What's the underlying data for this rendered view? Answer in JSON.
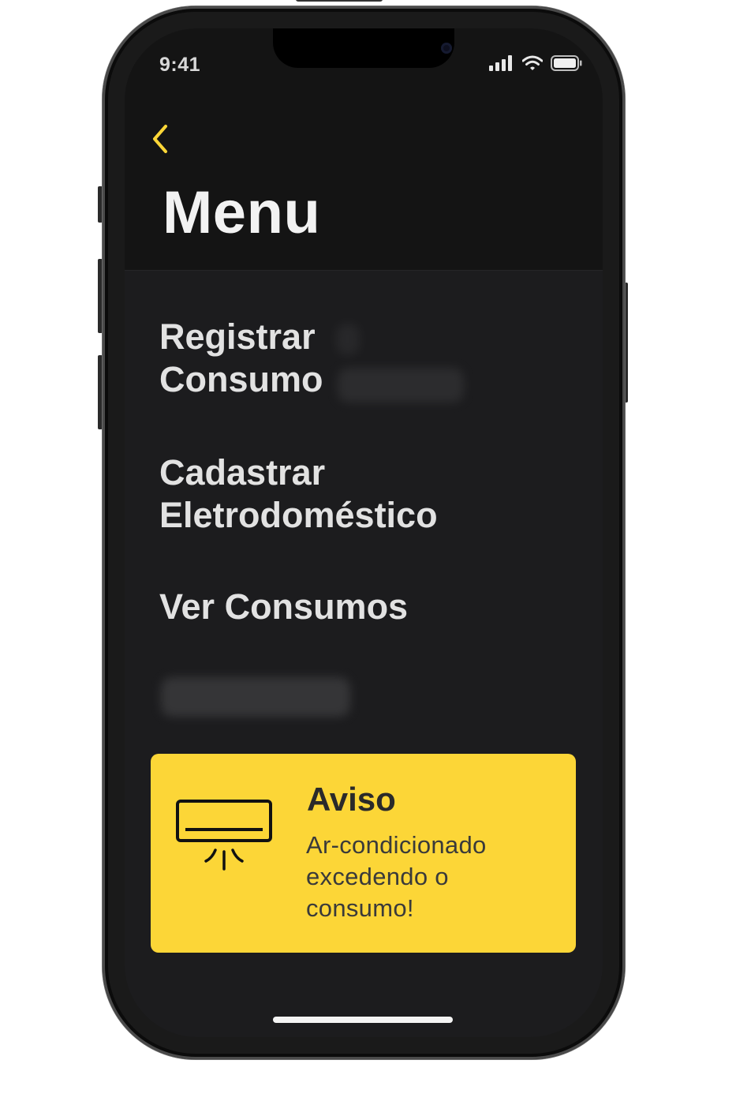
{
  "status_bar": {
    "time": "9:41",
    "signal_icon": "cellular-signal-icon",
    "wifi_icon": "wifi-icon",
    "battery_icon": "battery-icon"
  },
  "navigation": {
    "back_icon": "chevron-left-icon"
  },
  "header": {
    "title": "Menu"
  },
  "menu": {
    "items": [
      {
        "label": "Registrar\nConsumo"
      },
      {
        "label": "Cadastrar\nEletrodoméstico"
      },
      {
        "label": "Ver Consumos"
      }
    ]
  },
  "alert": {
    "icon": "air-conditioner-icon",
    "title": "Aviso",
    "message": "Ar-condicionado excedendo o consumo!"
  },
  "colors": {
    "accent": "#fcd637",
    "background": "#1c1c1e",
    "header_background": "#141414",
    "text": "#e2e2e2"
  }
}
